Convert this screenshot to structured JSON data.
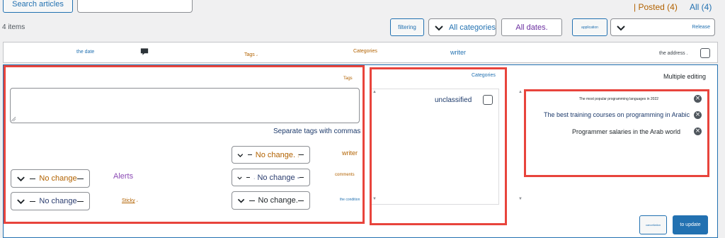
{
  "toolbar": {
    "search_button": "Search articles",
    "search_value": "",
    "posted_link": "| Posted (4)",
    "all_link": "All (4)",
    "items_count": "4 items",
    "filter_button": "filtering",
    "category_filter": "All categories",
    "date_filter": "All dates.",
    "apply_button": "application",
    "bulk_action": "Release"
  },
  "table_header": {
    "date": "the date",
    "tags": "Tags",
    "tags_suffix": "،",
    "categories": "Categories",
    "writer": "writer",
    "address": "the address ."
  },
  "bulk_edit": {
    "title": "Multiple editing",
    "tags_label": "Tags",
    "tags_help": "Separate tags with commas",
    "categories_label": "Categories",
    "category_item": "unclassified",
    "writer_label": "writer",
    "writer_value": "No change.",
    "writer_mark": "؛",
    "comments_label": "comments",
    "comments_value": "No change -",
    "comments_mark": "·",
    "status_label": "the condition",
    "status_value": "No change.",
    "alerts_label": "Alerts",
    "alerts_value": "No change",
    "sticky_label": "Sticky",
    "sticky_suffix": "،",
    "sticky_value": "No change",
    "posts": [
      "The most popular programming languages in 2022",
      "The best training courses on programming in Arabic",
      "Programmer salaries in the Arab world"
    ],
    "cancel_button": "cancellation",
    "update_button": "to update"
  },
  "colors": {
    "accent": "#2271b1",
    "highlight": "#e8443c",
    "orange_text": "#b26200",
    "purple_text": "#8c4bb5"
  },
  "icons": [
    "comment-icon",
    "chevron-down-icon",
    "remove-icon",
    "resize-handle-icon"
  ]
}
